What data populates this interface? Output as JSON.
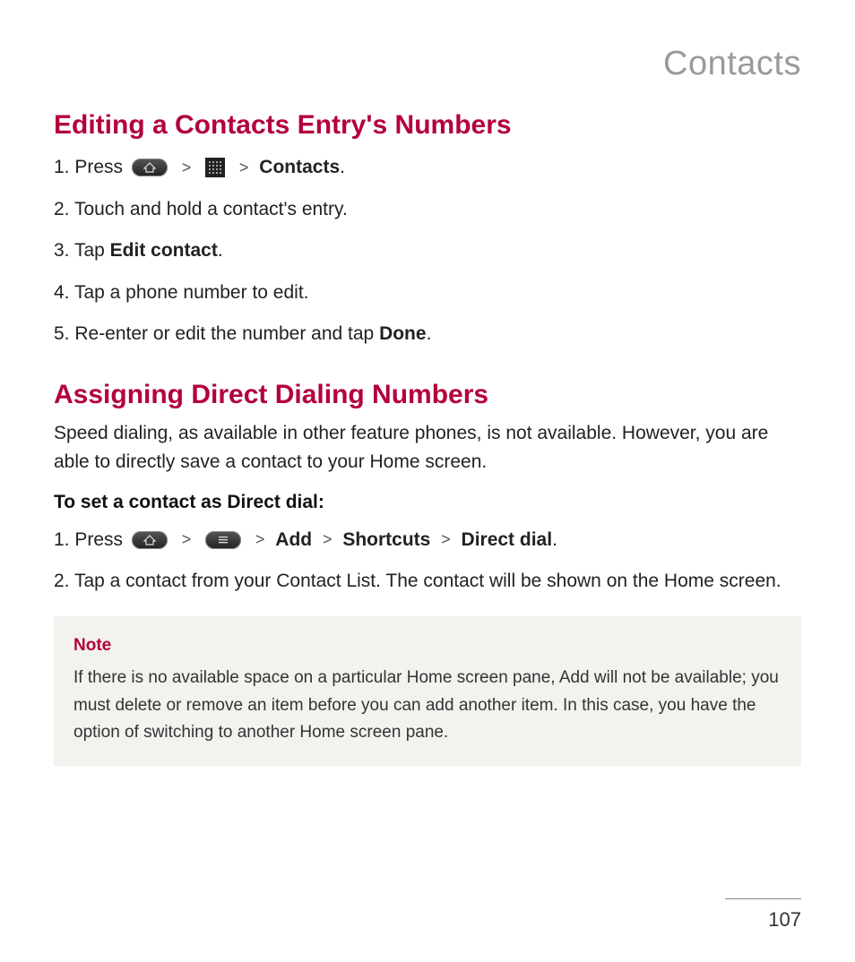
{
  "chapter": "Contacts",
  "section1": {
    "heading": "Editing a Contacts Entry's Numbers",
    "steps": {
      "s1_prefix": "1. Press ",
      "s1_contacts": "Contacts",
      "s1_period": ".",
      "s2": "2. Touch and hold a contact's entry.",
      "s3_prefix": "3. Tap ",
      "s3_bold": "Edit contact",
      "s3_period": ".",
      "s4": "4. Tap a phone number to edit.",
      "s5_prefix": "5. Re-enter or edit the number and tap ",
      "s5_bold": "Done",
      "s5_period": "."
    }
  },
  "section2": {
    "heading": "Assigning Direct Dialing Numbers",
    "intro": "Speed dialing, as available in other feature phones, is not available. However, you are able to directly save a contact to your Home screen.",
    "subheading": "To set a contact as Direct dial:",
    "steps": {
      "s1_prefix": "1. Press ",
      "s1_add": "Add",
      "s1_shortcuts": "Shortcuts",
      "s1_directdial": "Direct dial",
      "s1_period": ".",
      "s2": "2. Tap a contact from your Contact List. The contact will be shown on the Home screen."
    }
  },
  "note": {
    "label": "Note",
    "text": "If there is no available space on a particular Home screen pane, Add will not be available; you must delete or remove an item before you can add another item. In this case, you have the option of switching to another Home screen pane."
  },
  "gt": ">",
  "page_number": "107"
}
